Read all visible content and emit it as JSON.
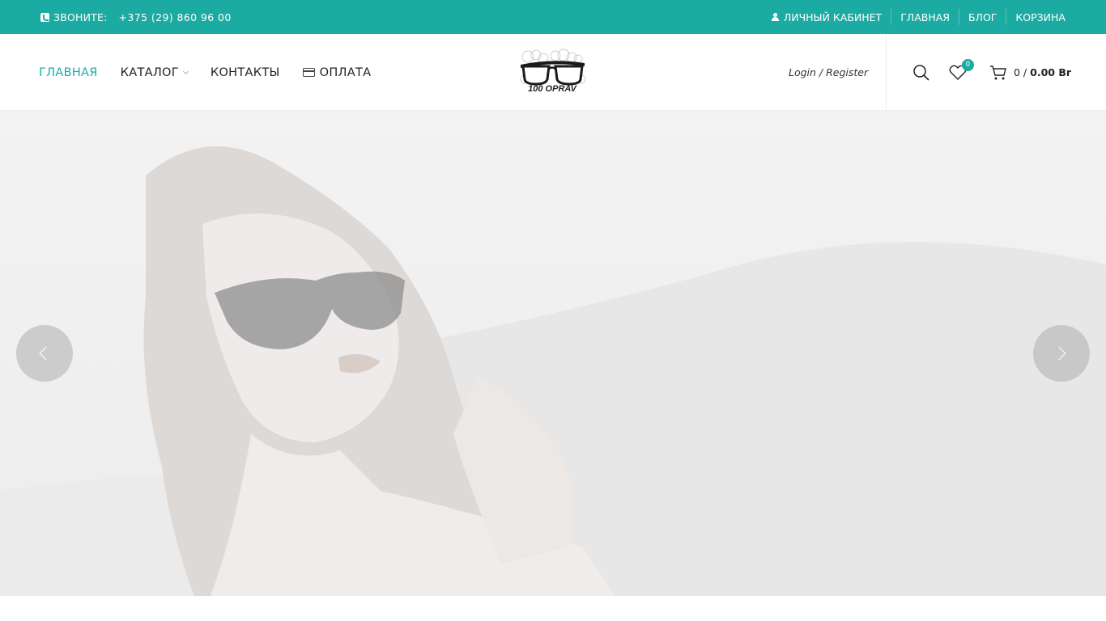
{
  "topbar": {
    "call_label": "ЗВОНИТЕ:",
    "phone": "+375 (29) 860 96 00",
    "links": [
      "ЛИЧНЫЙ КАБИНЕТ",
      "ГЛАВНАЯ",
      "БЛОГ",
      "КОРЗИНА"
    ]
  },
  "nav": {
    "items": [
      "ГЛАВНАЯ",
      "КАТАЛОГ",
      "КОНТАКТЫ",
      "ОПЛАТА"
    ]
  },
  "logo": {
    "text": "100 OPRAV"
  },
  "account": {
    "login_label": "Login / Register"
  },
  "wishlist": {
    "count": "0"
  },
  "cart": {
    "count": "0 /",
    "total": "0.00 Br"
  },
  "colors": {
    "accent": "#1caba2"
  },
  "icons": [
    "phone-icon",
    "user-icon",
    "chevron-down-icon",
    "credit-card-icon",
    "search-icon",
    "heart-icon",
    "cart-icon",
    "chevron-left-icon",
    "chevron-right-icon"
  ]
}
